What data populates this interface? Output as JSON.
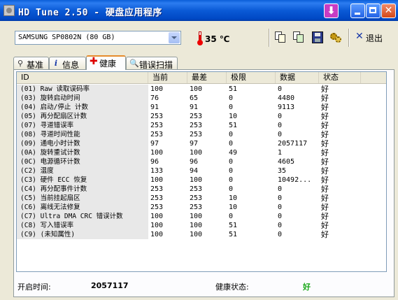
{
  "window": {
    "title": "HD Tune 2.50 - 硬盘应用程序"
  },
  "toolbar": {
    "drive": "SAMSUNG SP0802N (80 GB)",
    "temperature": "35 ℃",
    "exit_label": "退出"
  },
  "tabs": [
    {
      "label": "基准",
      "icon": "benchmark-icon"
    },
    {
      "label": "信息",
      "icon": "info-icon"
    },
    {
      "label": "健康",
      "icon": "health-cross-icon",
      "active": true
    },
    {
      "label": "错误扫描",
      "icon": "search-icon"
    }
  ],
  "table": {
    "headers": {
      "id": "ID",
      "current": "当前",
      "worst": "最差",
      "threshold": "极限",
      "data": "数据",
      "status": "状态"
    },
    "rows": [
      {
        "id": "(01) Raw 读取误码率",
        "current": "100",
        "worst": "100",
        "threshold": "51",
        "data": "0",
        "status": "好"
      },
      {
        "id": "(03) 旋转启动时间",
        "current": "76",
        "worst": "65",
        "threshold": "0",
        "data": "4480",
        "status": "好"
      },
      {
        "id": "(04) 启动/停止 计数",
        "current": "91",
        "worst": "91",
        "threshold": "0",
        "data": "9113",
        "status": "好"
      },
      {
        "id": "(05) 再分配扇区计数",
        "current": "253",
        "worst": "253",
        "threshold": "10",
        "data": "0",
        "status": "好"
      },
      {
        "id": "(07) 寻道错误率",
        "current": "253",
        "worst": "253",
        "threshold": "51",
        "data": "0",
        "status": "好"
      },
      {
        "id": "(08) 寻道时间性能",
        "current": "253",
        "worst": "253",
        "threshold": "0",
        "data": "0",
        "status": "好"
      },
      {
        "id": "(09) 通电小时计数",
        "current": "97",
        "worst": "97",
        "threshold": "0",
        "data": "2057117",
        "status": "好"
      },
      {
        "id": "(0A) 旋转重试计数",
        "current": "100",
        "worst": "100",
        "threshold": "49",
        "data": "1",
        "status": "好"
      },
      {
        "id": "(0C) 电源循环计数",
        "current": "96",
        "worst": "96",
        "threshold": "0",
        "data": "4605",
        "status": "好"
      },
      {
        "id": "(C2) 温度",
        "current": "133",
        "worst": "94",
        "threshold": "0",
        "data": "35",
        "status": "好"
      },
      {
        "id": "(C3) 硬件 ECC 恢复",
        "current": "100",
        "worst": "100",
        "threshold": "0",
        "data": "10492...",
        "status": "好"
      },
      {
        "id": "(C4) 再分配事件计数",
        "current": "253",
        "worst": "253",
        "threshold": "0",
        "data": "0",
        "status": "好"
      },
      {
        "id": "(C5) 当前挂起扇区",
        "current": "253",
        "worst": "253",
        "threshold": "10",
        "data": "0",
        "status": "好"
      },
      {
        "id": "(C6) 离线无法修复",
        "current": "253",
        "worst": "253",
        "threshold": "10",
        "data": "0",
        "status": "好"
      },
      {
        "id": "(C7) Ultra DMA CRC 错误计数",
        "current": "100",
        "worst": "100",
        "threshold": "0",
        "data": "0",
        "status": "好"
      },
      {
        "id": "(C8) 写入错误率",
        "current": "100",
        "worst": "100",
        "threshold": "51",
        "data": "0",
        "status": "好"
      },
      {
        "id": "(C9) (未知属性)",
        "current": "100",
        "worst": "100",
        "threshold": "51",
        "data": "0",
        "status": "好"
      }
    ]
  },
  "footer": {
    "power_on_label": "开启时间:",
    "power_on_value": "2057117",
    "health_label": "健康状态:",
    "health_value": "好"
  },
  "colors": {
    "title_bar": "#0a5ad6",
    "active_tab_accent": "#e68b2c",
    "health_good": "#1aa81a"
  }
}
